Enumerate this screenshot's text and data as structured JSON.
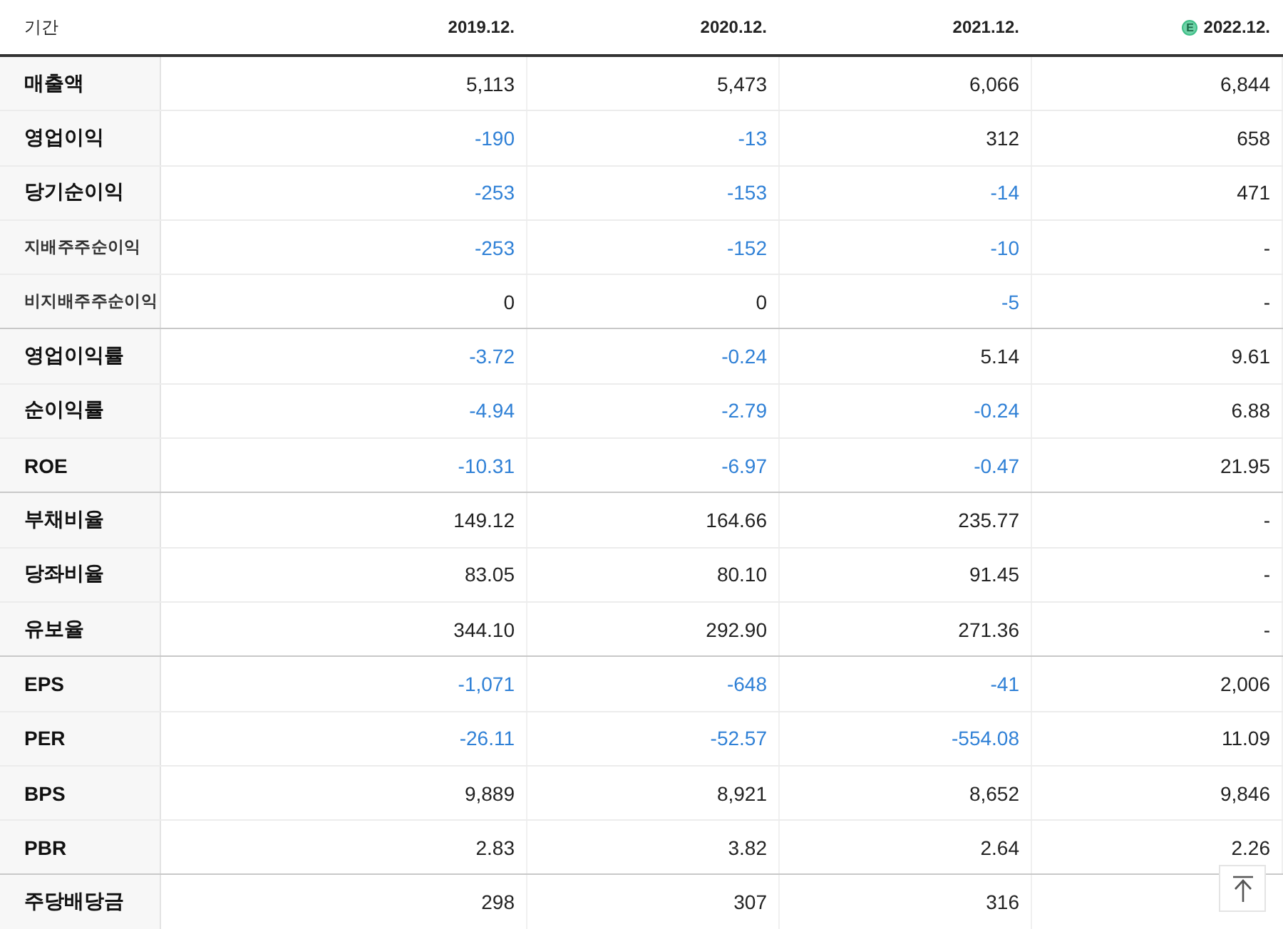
{
  "table": {
    "header_label": "기간",
    "columns": [
      {
        "label": "2019.12."
      },
      {
        "label": "2020.12."
      },
      {
        "label": "2021.12."
      },
      {
        "label": "2022.12.",
        "badge": "E"
      }
    ],
    "rows": [
      {
        "label": "매출액",
        "kind": "main",
        "group_end": false,
        "values": [
          "5,113",
          "5,473",
          "6,066",
          "6,844"
        ]
      },
      {
        "label": "영업이익",
        "kind": "main",
        "group_end": false,
        "values": [
          "-190",
          "-13",
          "312",
          "658"
        ]
      },
      {
        "label": "당기순이익",
        "kind": "main",
        "group_end": false,
        "values": [
          "-253",
          "-153",
          "-14",
          "471"
        ]
      },
      {
        "label": "지배주주순이익",
        "kind": "sub",
        "group_end": false,
        "values": [
          "-253",
          "-152",
          "-10",
          "-"
        ]
      },
      {
        "label": "비지배주주순이익",
        "kind": "sub",
        "group_end": true,
        "values": [
          "0",
          "0",
          "-5",
          "-"
        ]
      },
      {
        "label": "영업이익률",
        "kind": "main",
        "group_end": false,
        "values": [
          "-3.72",
          "-0.24",
          "5.14",
          "9.61"
        ]
      },
      {
        "label": "순이익률",
        "kind": "main",
        "group_end": false,
        "values": [
          "-4.94",
          "-2.79",
          "-0.24",
          "6.88"
        ]
      },
      {
        "label": "ROE",
        "kind": "main",
        "group_end": true,
        "values": [
          "-10.31",
          "-6.97",
          "-0.47",
          "21.95"
        ]
      },
      {
        "label": "부채비율",
        "kind": "main",
        "group_end": false,
        "values": [
          "149.12",
          "164.66",
          "235.77",
          "-"
        ]
      },
      {
        "label": "당좌비율",
        "kind": "main",
        "group_end": false,
        "values": [
          "83.05",
          "80.10",
          "91.45",
          "-"
        ]
      },
      {
        "label": "유보율",
        "kind": "main",
        "group_end": true,
        "values": [
          "344.10",
          "292.90",
          "271.36",
          "-"
        ]
      },
      {
        "label": "EPS",
        "kind": "main",
        "group_end": false,
        "values": [
          "-1,071",
          "-648",
          "-41",
          "2,006"
        ]
      },
      {
        "label": "PER",
        "kind": "main",
        "group_end": false,
        "values": [
          "-26.11",
          "-52.57",
          "-554.08",
          "11.09"
        ]
      },
      {
        "label": "BPS",
        "kind": "main",
        "group_end": false,
        "values": [
          "9,889",
          "8,921",
          "8,652",
          "9,846"
        ]
      },
      {
        "label": "PBR",
        "kind": "main",
        "group_end": true,
        "values": [
          "2.83",
          "3.82",
          "2.64",
          "2.26"
        ]
      },
      {
        "label": "주당배당금",
        "kind": "main",
        "values": [
          "298",
          "307",
          "316"
        ]
      }
    ]
  }
}
